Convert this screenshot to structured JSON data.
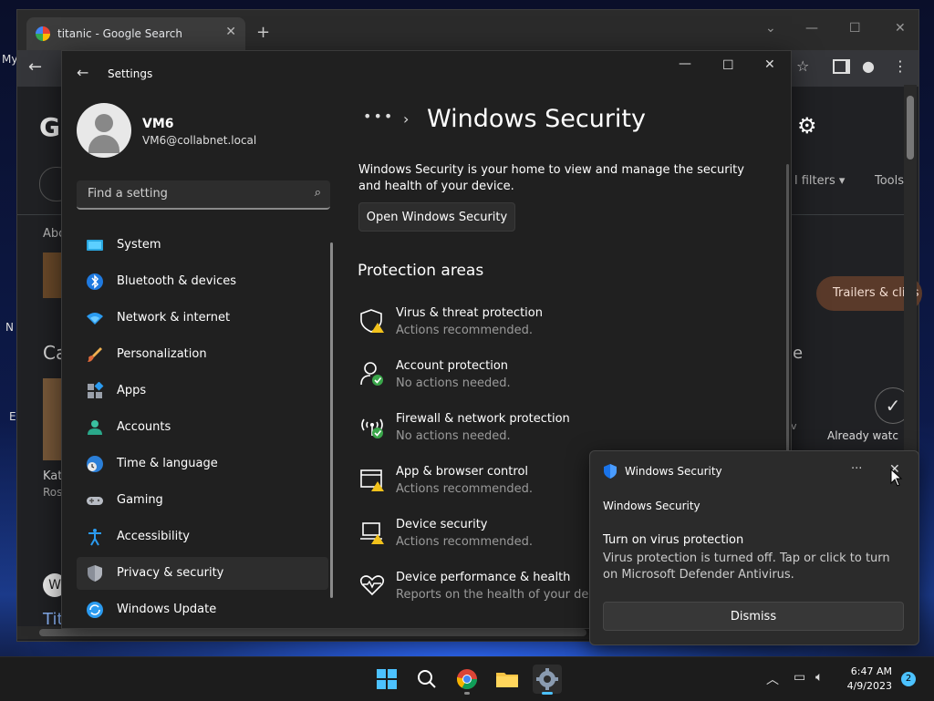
{
  "desktop": {
    "left_texts": [
      "My",
      "N",
      "E"
    ]
  },
  "browser": {
    "tab_title": "titanic - Google Search",
    "g_letter": "G",
    "filters_label": "l filters ▾",
    "tools_label": "Tools",
    "about_label": "Abo",
    "ca_label": "Ca",
    "e_label": "e",
    "trailers_label": "Trailers & clips",
    "already_label": "Already watc",
    "v_label": "v",
    "kat_label": "Kat",
    "ros_label": "Ros",
    "w_label": "W",
    "tit_label": "Tit"
  },
  "settings": {
    "title": "Settings",
    "user": {
      "name": "VM6",
      "email": "VM6@collabnet.local"
    },
    "search_placeholder": "Find a setting",
    "nav": [
      {
        "label": "System",
        "icon": "system-icon"
      },
      {
        "label": "Bluetooth & devices",
        "icon": "bluetooth-icon"
      },
      {
        "label": "Network & internet",
        "icon": "wifi-icon"
      },
      {
        "label": "Personalization",
        "icon": "brush-icon"
      },
      {
        "label": "Apps",
        "icon": "apps-icon"
      },
      {
        "label": "Accounts",
        "icon": "accounts-icon"
      },
      {
        "label": "Time & language",
        "icon": "clock-globe-icon"
      },
      {
        "label": "Gaming",
        "icon": "gamepad-icon"
      },
      {
        "label": "Accessibility",
        "icon": "accessibility-icon"
      },
      {
        "label": "Privacy & security",
        "icon": "shield-icon",
        "active": true
      },
      {
        "label": "Windows Update",
        "icon": "update-icon"
      }
    ],
    "breadcrumb_dots": "•••",
    "page_title": "Windows Security",
    "description": "Windows Security is your home to view and manage the security and health of your device.",
    "open_button": "Open Windows Security",
    "section_title": "Protection areas",
    "areas": [
      {
        "title": "Virus & threat protection",
        "status": "Actions recommended.",
        "icon": "virus-shield-warning-icon"
      },
      {
        "title": "Account protection",
        "status": "No actions needed.",
        "icon": "account-check-icon"
      },
      {
        "title": "Firewall & network protection",
        "status": "No actions needed.",
        "icon": "firewall-check-icon"
      },
      {
        "title": "App & browser control",
        "status": "Actions recommended.",
        "icon": "browser-warning-icon"
      },
      {
        "title": "Device security",
        "status": "Actions recommended.",
        "icon": "device-warning-icon"
      },
      {
        "title": "Device performance & health",
        "status": "Reports on the health of your devic",
        "icon": "heart-icon"
      }
    ]
  },
  "toast": {
    "app_name": "Windows Security",
    "subtitle": "Windows Security",
    "title": "Turn on virus protection",
    "body": "Virus protection is turned off. Tap or click to turn on Microsoft Defender Antivirus.",
    "dismiss": "Dismiss"
  },
  "taskbar": {
    "time": "6:47 AM",
    "date": "4/9/2023",
    "badge": "2"
  }
}
